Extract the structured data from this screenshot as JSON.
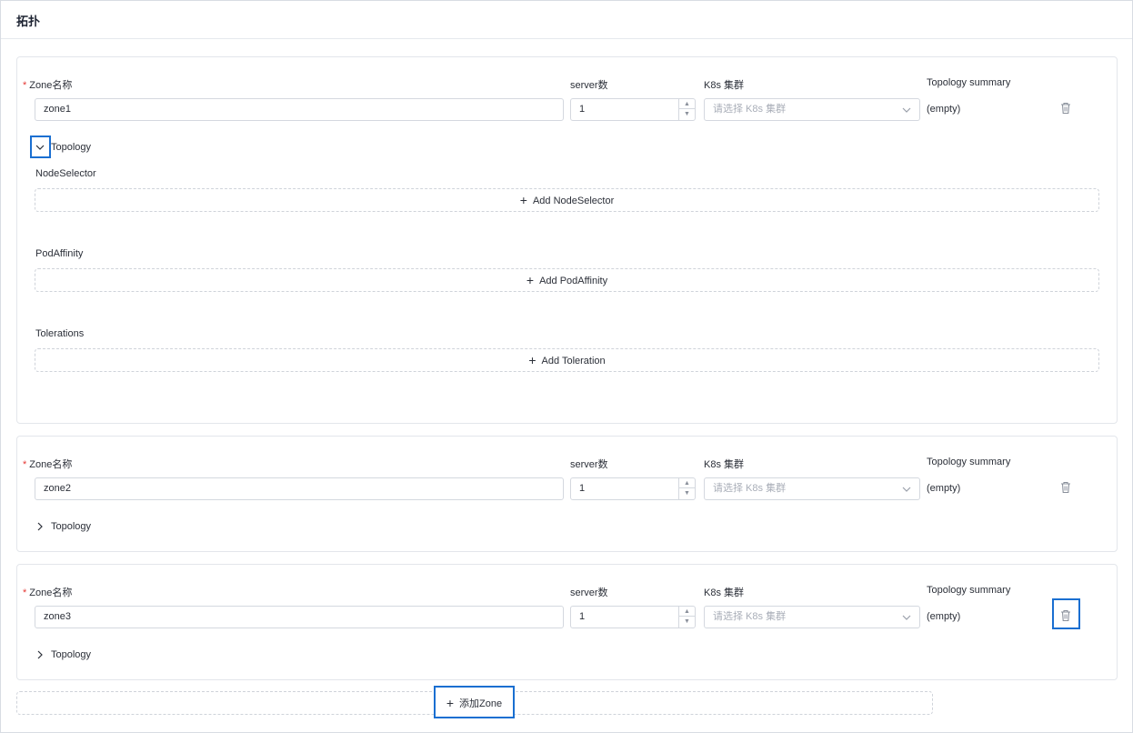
{
  "header": {
    "title": "拓扑"
  },
  "labels": {
    "zone_name": "Zone名称",
    "required_mark": "*",
    "server_count": "server数",
    "k8s_cluster": "K8s 集群",
    "topology_summary": "Topology summary",
    "topology_toggle": "Topology"
  },
  "k8s_placeholder": "请选择 K8s 集群",
  "zones": [
    {
      "name": "zone1",
      "servers": "1",
      "summary": "(empty)",
      "expanded": true
    },
    {
      "name": "zone2",
      "servers": "1",
      "summary": "(empty)",
      "expanded": false
    },
    {
      "name": "zone3",
      "servers": "1",
      "summary": "(empty)",
      "expanded": false
    }
  ],
  "topology": {
    "node_selector_label": "NodeSelector",
    "add_node_selector": "Add NodeSelector",
    "pod_affinity_label": "PodAffinity",
    "add_pod_affinity": "Add PodAffinity",
    "tolerations_label": "Tolerations",
    "add_toleration": "Add Toleration"
  },
  "add_zone_button": "添加Zone",
  "icons": {
    "up": "chevron-up-icon",
    "down": "chevron-down-icon",
    "right": "chevron-right-icon",
    "trash": "trash-icon",
    "plus": "plus-icon"
  },
  "colors": {
    "highlight": "#1a6fd1",
    "required": "#e53935"
  }
}
